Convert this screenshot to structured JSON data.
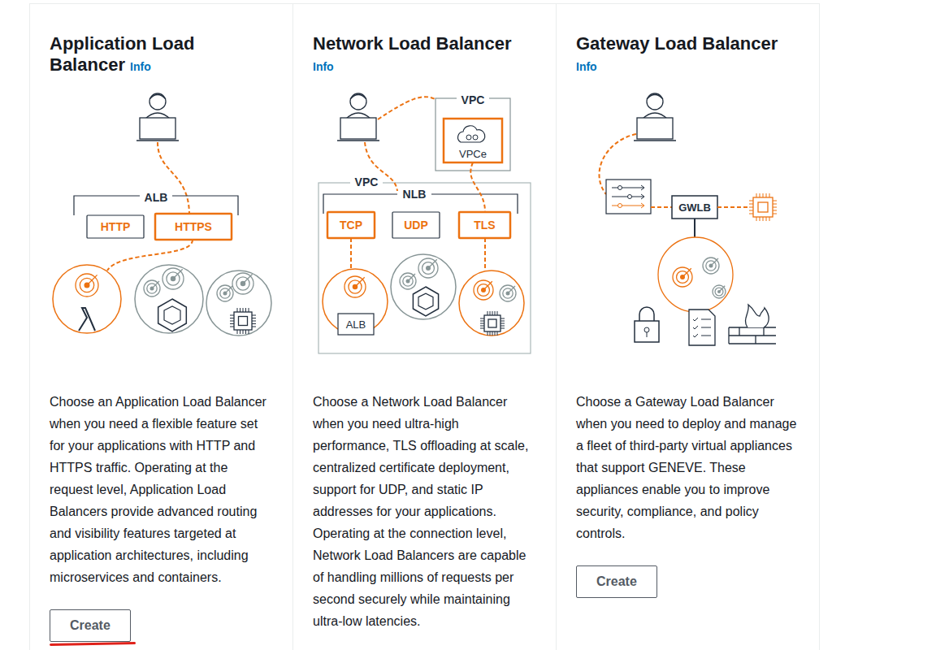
{
  "cards": [
    {
      "title": "Application Load Balancer",
      "info": "Info",
      "description": "Choose an Application Load Balancer when you need a flexible feature set for your applications with HTTP and HTTPS traffic. Operating at the request level, Application Load Balancers provide advanced routing and visibility features targeted at application architectures, including microservices and containers.",
      "button": {
        "label": "Create",
        "marked": true
      },
      "diagram": {
        "kind": "alb",
        "group": "ALB",
        "listeners": [
          {
            "label": "HTTP",
            "highlighted": false
          },
          {
            "label": "HTTPS",
            "highlighted": true
          }
        ]
      }
    },
    {
      "title": "Network Load Balancer",
      "info": "Info",
      "description": "Choose a Network Load Balancer when you need ultra-high performance, TLS offloading at scale, centralized certificate deployment, support for UDP, and static IP addresses for your applications. Operating at the connection level, Network Load Balancers are capable of handling millions of requests per second securely while maintaining ultra-low latencies.",
      "diagram": {
        "kind": "nlb",
        "vpc": "VPC",
        "endpoint_vpc": "VPC",
        "endpoint": "VPCe",
        "group": "NLB",
        "target": "ALB",
        "listeners": [
          {
            "label": "TCP",
            "highlighted": true
          },
          {
            "label": "UDP",
            "highlighted": false
          },
          {
            "label": "TLS",
            "highlighted": true
          }
        ]
      }
    },
    {
      "title": "Gateway Load Balancer",
      "info": "Info",
      "description": "Choose a Gateway Load Balancer when you need to deploy and manage a fleet of third-party virtual appliances that support GENEVE. These appliances enable you to improve security, compliance, and policy controls.",
      "button": {
        "label": "Create",
        "marked": false
      },
      "diagram": {
        "kind": "gwlb",
        "group": "GWLB"
      }
    }
  ]
}
